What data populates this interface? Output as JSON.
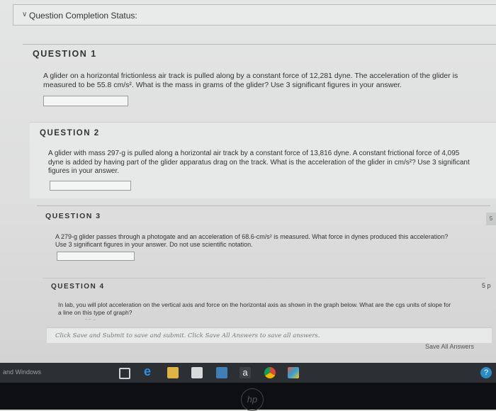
{
  "status": {
    "label": "Question Completion Status:"
  },
  "questions": [
    {
      "title": "QUESTION 1",
      "text": "A glider on a horizontal frictionless air track is pulled along by a constant force of 12,281 dyne. The acceleration of the glider is measured to be 55.8 cm/s². What is the mass in grams of the glider? Use 3 significant figures in your answer."
    },
    {
      "title": "QUESTION 2",
      "text": "A glider with mass 297-g is pulled along a horizontal air track by a constant force of 13,816 dyne. A constant frictional force of 4,095 dyne is added by having part of the glider apparatus drag on the track. What is the acceleration of the glider in cm/s²? Use 3 significant figures in your answer."
    },
    {
      "title": "QUESTION 3",
      "text": "A 279-g glider passes through a photogate and an acceleration of 68.6-cm/s² is measured. What force in dynes produced this acceleration? Use 3 significant figures in your answer. Do not use scientific notation."
    },
    {
      "title": "QUESTION 4",
      "text": "In lab, you will plot acceleration on the vertical axis and force on the horizontal axis as shown in the graph below. What are the cgs units of slope for a line on this type of graph?",
      "points": "5 p"
    }
  ],
  "side_tab": "5",
  "submit_hint": "Click Save and Submit to save and submit. Click Save All Answers to save all answers.",
  "save_all_label": "Save All Answers",
  "taskbar": {
    "windows_text": "and Windows"
  },
  "logo": "hp"
}
